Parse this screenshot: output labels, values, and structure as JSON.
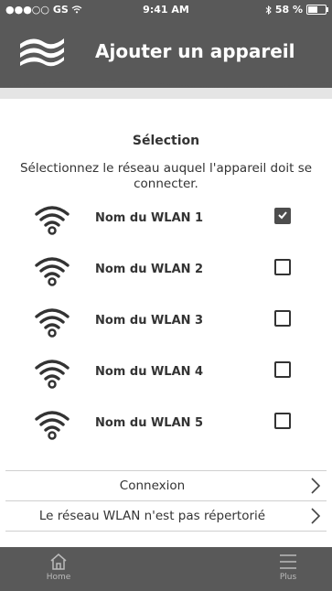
{
  "status_bar": {
    "carrier": "●●●○○ GS",
    "time": "9:41 AM",
    "battery": "58 %",
    "battery_level": 0.58
  },
  "header": {
    "title": "Ajouter un appareil"
  },
  "selection": {
    "title": "Sélection",
    "instruction": "Sélectionnez le réseau auquel l'appareil doit se connecter."
  },
  "networks": [
    {
      "name": "Nom du WLAN 1",
      "selected": true
    },
    {
      "name": "Nom du WLAN 2",
      "selected": false
    },
    {
      "name": "Nom du WLAN 3",
      "selected": false
    },
    {
      "name": "Nom du WLAN 4",
      "selected": false
    },
    {
      "name": "Nom du WLAN 5",
      "selected": false
    }
  ],
  "actions": {
    "connect": "Connexion",
    "not_listed": "Le réseau WLAN n'est pas répertorié"
  },
  "tabs": {
    "home": "Home",
    "more": "Plus"
  },
  "colors": {
    "header_bg": "#595959",
    "footer_bg": "#595959",
    "content_bg": "#ffffff"
  },
  "icons": {
    "logo": "wave-logo-icon",
    "network": "wifi-icon",
    "chevron": "chevron-right-icon",
    "home": "home-icon",
    "more": "menu-icon"
  }
}
